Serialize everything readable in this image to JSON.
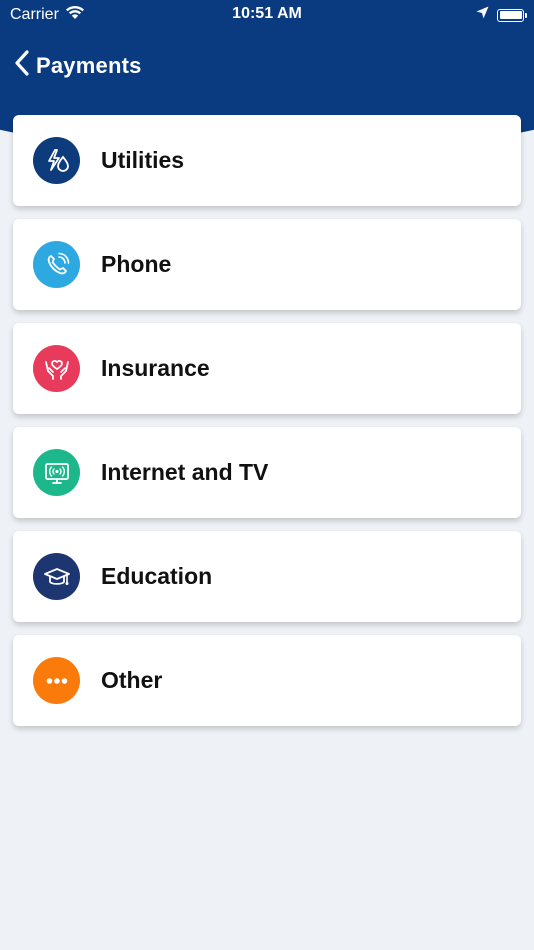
{
  "status_bar": {
    "carrier": "Carrier",
    "time": "10:51 AM"
  },
  "nav": {
    "back_label": "Payments"
  },
  "colors": {
    "header": "#0a3b80",
    "background": "#eef2f6"
  },
  "categories": [
    {
      "label": "Utilities",
      "icon": "utilities-icon",
      "color": "#0e3b7c"
    },
    {
      "label": "Phone",
      "icon": "phone-icon",
      "color": "#2ea8e0"
    },
    {
      "label": "Insurance",
      "icon": "insurance-icon",
      "color": "#e83a5b"
    },
    {
      "label": "Internet and TV",
      "icon": "internet-tv-icon",
      "color": "#1cb88c"
    },
    {
      "label": "Education",
      "icon": "education-icon",
      "color": "#1d3570"
    },
    {
      "label": "Other",
      "icon": "more-icon",
      "color": "#fa7a0c"
    }
  ]
}
